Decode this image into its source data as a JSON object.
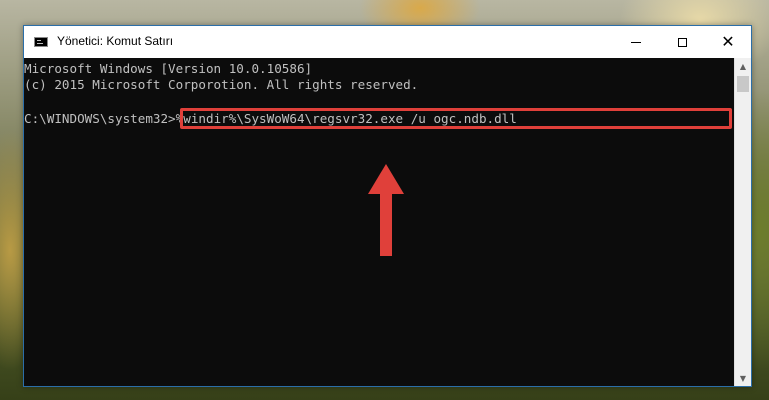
{
  "window": {
    "title": "Yönetici: Komut Satırı",
    "controls": {
      "minimize_icon": "minimize-icon",
      "maximize_icon": "maximize-icon",
      "close_glyph": "✕"
    }
  },
  "console": {
    "lines": [
      "Microsoft Windows [Version 10.0.10586]",
      "(c) 2015 Microsoft Corporotion. All rights reserved."
    ],
    "prompt": "C:\\WINDOWS\\system32>",
    "command": "%windir%\\SysWoW64\\regsvr32.exe /u ogc.ndb.dll"
  },
  "annotation": {
    "highlight_color": "#e0403a",
    "arrow_icon": "up-arrow-icon"
  },
  "scrollbar": {
    "up_glyph": "▲",
    "down_glyph": "▼"
  }
}
